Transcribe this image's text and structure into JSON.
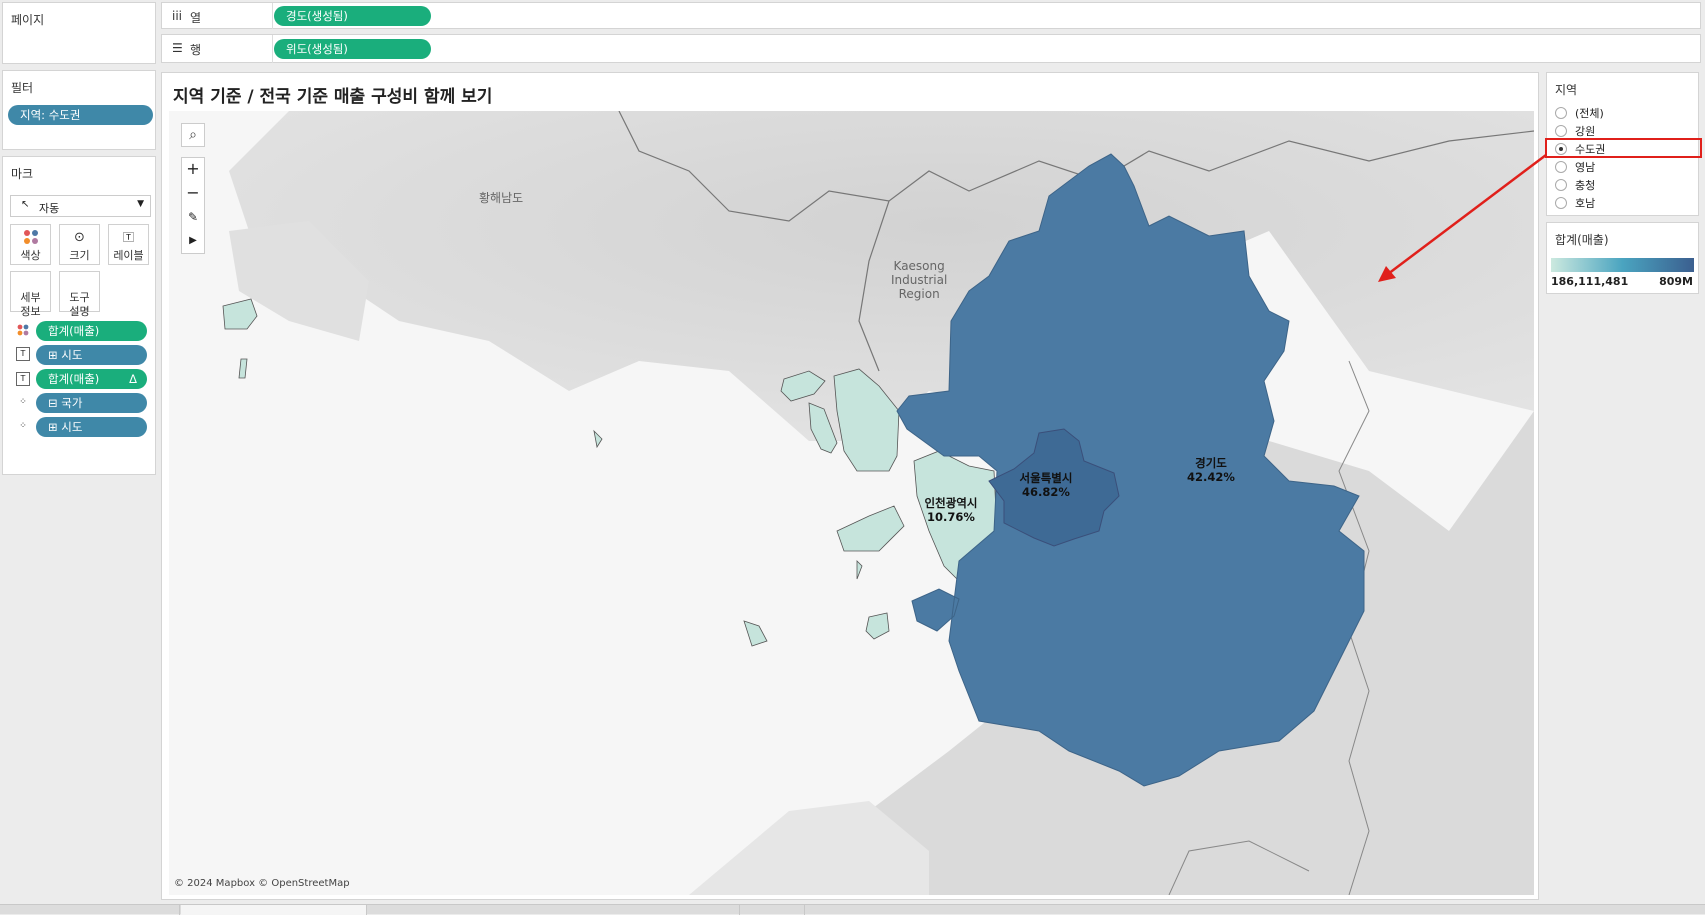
{
  "shelves": {
    "pages_label": "페이지",
    "columns": {
      "icon": "iii",
      "label": "열",
      "pill": "경도(생성됨)"
    },
    "rows": {
      "icon": "☰",
      "label": "행",
      "pill": "위도(생성됨)"
    }
  },
  "filters": {
    "title": "필터",
    "pill": "지역: 수도권"
  },
  "marks": {
    "title": "마크",
    "type": "자동",
    "buttons": [
      {
        "label": "색상"
      },
      {
        "label": "크기"
      },
      {
        "label": "레이블"
      },
      {
        "label": "세부\n정보"
      },
      {
        "label": "도구\n설명"
      }
    ],
    "pills": [
      {
        "label": "합계(매출)",
        "icon": "color"
      },
      {
        "label": "⊞ 시도",
        "icon": "text"
      },
      {
        "label": "합계(매출)",
        "icon": "text",
        "delta": "Δ"
      },
      {
        "label": "⊟ 국가",
        "icon": "detail"
      },
      {
        "label": "⊞ 시도",
        "icon": "detail"
      }
    ]
  },
  "viz": {
    "title": "지역 기준 / 전국 기준 매출 구성비 함께 보기",
    "attribution": "© 2024 Mapbox © OpenStreetMap",
    "base_labels": {
      "hwanghae": "황해남도",
      "kaesong": "Kaesong\nIndustrial\nRegion"
    },
    "regions": [
      {
        "name": "서울특별시",
        "pct": "46.82%"
      },
      {
        "name": "경기도",
        "pct": "42.42%"
      },
      {
        "name": "인천광역시",
        "pct": "10.76%"
      }
    ]
  },
  "region_filter": {
    "title": "지역",
    "options": [
      {
        "label": "(전체)",
        "selected": false
      },
      {
        "label": "강원",
        "selected": false
      },
      {
        "label": "수도권",
        "selected": true
      },
      {
        "label": "영남",
        "selected": false
      },
      {
        "label": "충청",
        "selected": false
      },
      {
        "label": "호남",
        "selected": false
      }
    ]
  },
  "legend": {
    "title": "합계(매출)",
    "min_label": "186,111,481",
    "max_label": "809M"
  },
  "colors": {
    "seoul": "#3e6a95",
    "gyeonggi": "#4b7aa3",
    "incheon": "#c6e4dc",
    "pill_green": "#1aae7c",
    "pill_blue": "#3f88a8",
    "highlight": "#e0201b"
  }
}
